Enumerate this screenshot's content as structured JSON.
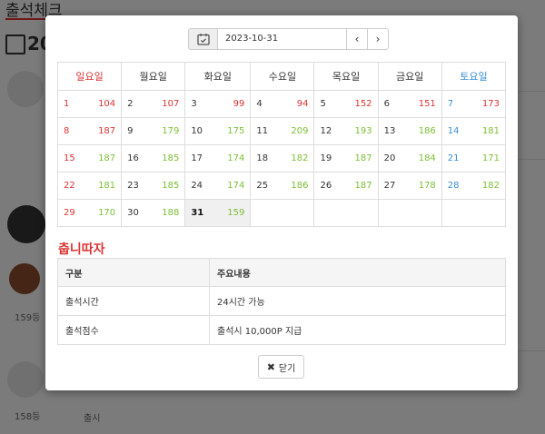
{
  "background": {
    "page_title": "출석체크",
    "year_partial": "20",
    "rank_a": "159등",
    "rank_b": "158등",
    "bottom_text": "출시"
  },
  "modal": {
    "date_value": "2023-10-31",
    "prev_label": "‹",
    "next_label": "›",
    "weekdays": [
      "일요일",
      "월요일",
      "화요일",
      "수요일",
      "목요일",
      "금요일",
      "토요일"
    ],
    "weeks": [
      [
        {
          "day": "1",
          "count": "104",
          "count_color": "red"
        },
        {
          "day": "2",
          "count": "107",
          "count_color": "red"
        },
        {
          "day": "3",
          "count": "99",
          "count_color": "red"
        },
        {
          "day": "4",
          "count": "94",
          "count_color": "red"
        },
        {
          "day": "5",
          "count": "152",
          "count_color": "red"
        },
        {
          "day": "6",
          "count": "151",
          "count_color": "red"
        },
        {
          "day": "7",
          "count": "173",
          "count_color": "red"
        }
      ],
      [
        {
          "day": "8",
          "count": "187",
          "count_color": "red"
        },
        {
          "day": "9",
          "count": "179",
          "count_color": "green"
        },
        {
          "day": "10",
          "count": "175",
          "count_color": "green"
        },
        {
          "day": "11",
          "count": "209",
          "count_color": "green"
        },
        {
          "day": "12",
          "count": "193",
          "count_color": "green"
        },
        {
          "day": "13",
          "count": "186",
          "count_color": "green"
        },
        {
          "day": "14",
          "count": "181",
          "count_color": "green"
        }
      ],
      [
        {
          "day": "15",
          "count": "187",
          "count_color": "green"
        },
        {
          "day": "16",
          "count": "185",
          "count_color": "green"
        },
        {
          "day": "17",
          "count": "174",
          "count_color": "green"
        },
        {
          "day": "18",
          "count": "182",
          "count_color": "green"
        },
        {
          "day": "19",
          "count": "187",
          "count_color": "green"
        },
        {
          "day": "20",
          "count": "184",
          "count_color": "green"
        },
        {
          "day": "21",
          "count": "171",
          "count_color": "green"
        }
      ],
      [
        {
          "day": "22",
          "count": "181",
          "count_color": "green"
        },
        {
          "day": "23",
          "count": "185",
          "count_color": "green"
        },
        {
          "day": "24",
          "count": "174",
          "count_color": "green"
        },
        {
          "day": "25",
          "count": "186",
          "count_color": "green"
        },
        {
          "day": "26",
          "count": "187",
          "count_color": "green"
        },
        {
          "day": "27",
          "count": "178",
          "count_color": "green"
        },
        {
          "day": "28",
          "count": "182",
          "count_color": "green"
        }
      ],
      [
        {
          "day": "29",
          "count": "170",
          "count_color": "green"
        },
        {
          "day": "30",
          "count": "188",
          "count_color": "green"
        },
        {
          "day": "31",
          "count": "159",
          "count_color": "green",
          "today": true
        },
        {
          "day": "",
          "count": ""
        },
        {
          "day": "",
          "count": ""
        },
        {
          "day": "",
          "count": ""
        },
        {
          "day": "",
          "count": ""
        }
      ]
    ],
    "info_title": "춥니따자",
    "info_headers": [
      "구분",
      "주요내용"
    ],
    "info_rows": [
      [
        "출석시간",
        "24시간 가능"
      ],
      [
        "출석점수",
        "출석시 10,000P 지급"
      ]
    ],
    "close_label": "닫기",
    "colors": {
      "sunday": "#d33333",
      "saturday": "#3a8ed8",
      "count_red": "#d33333",
      "count_green": "#7cbf35",
      "accent": "#d33333"
    }
  }
}
